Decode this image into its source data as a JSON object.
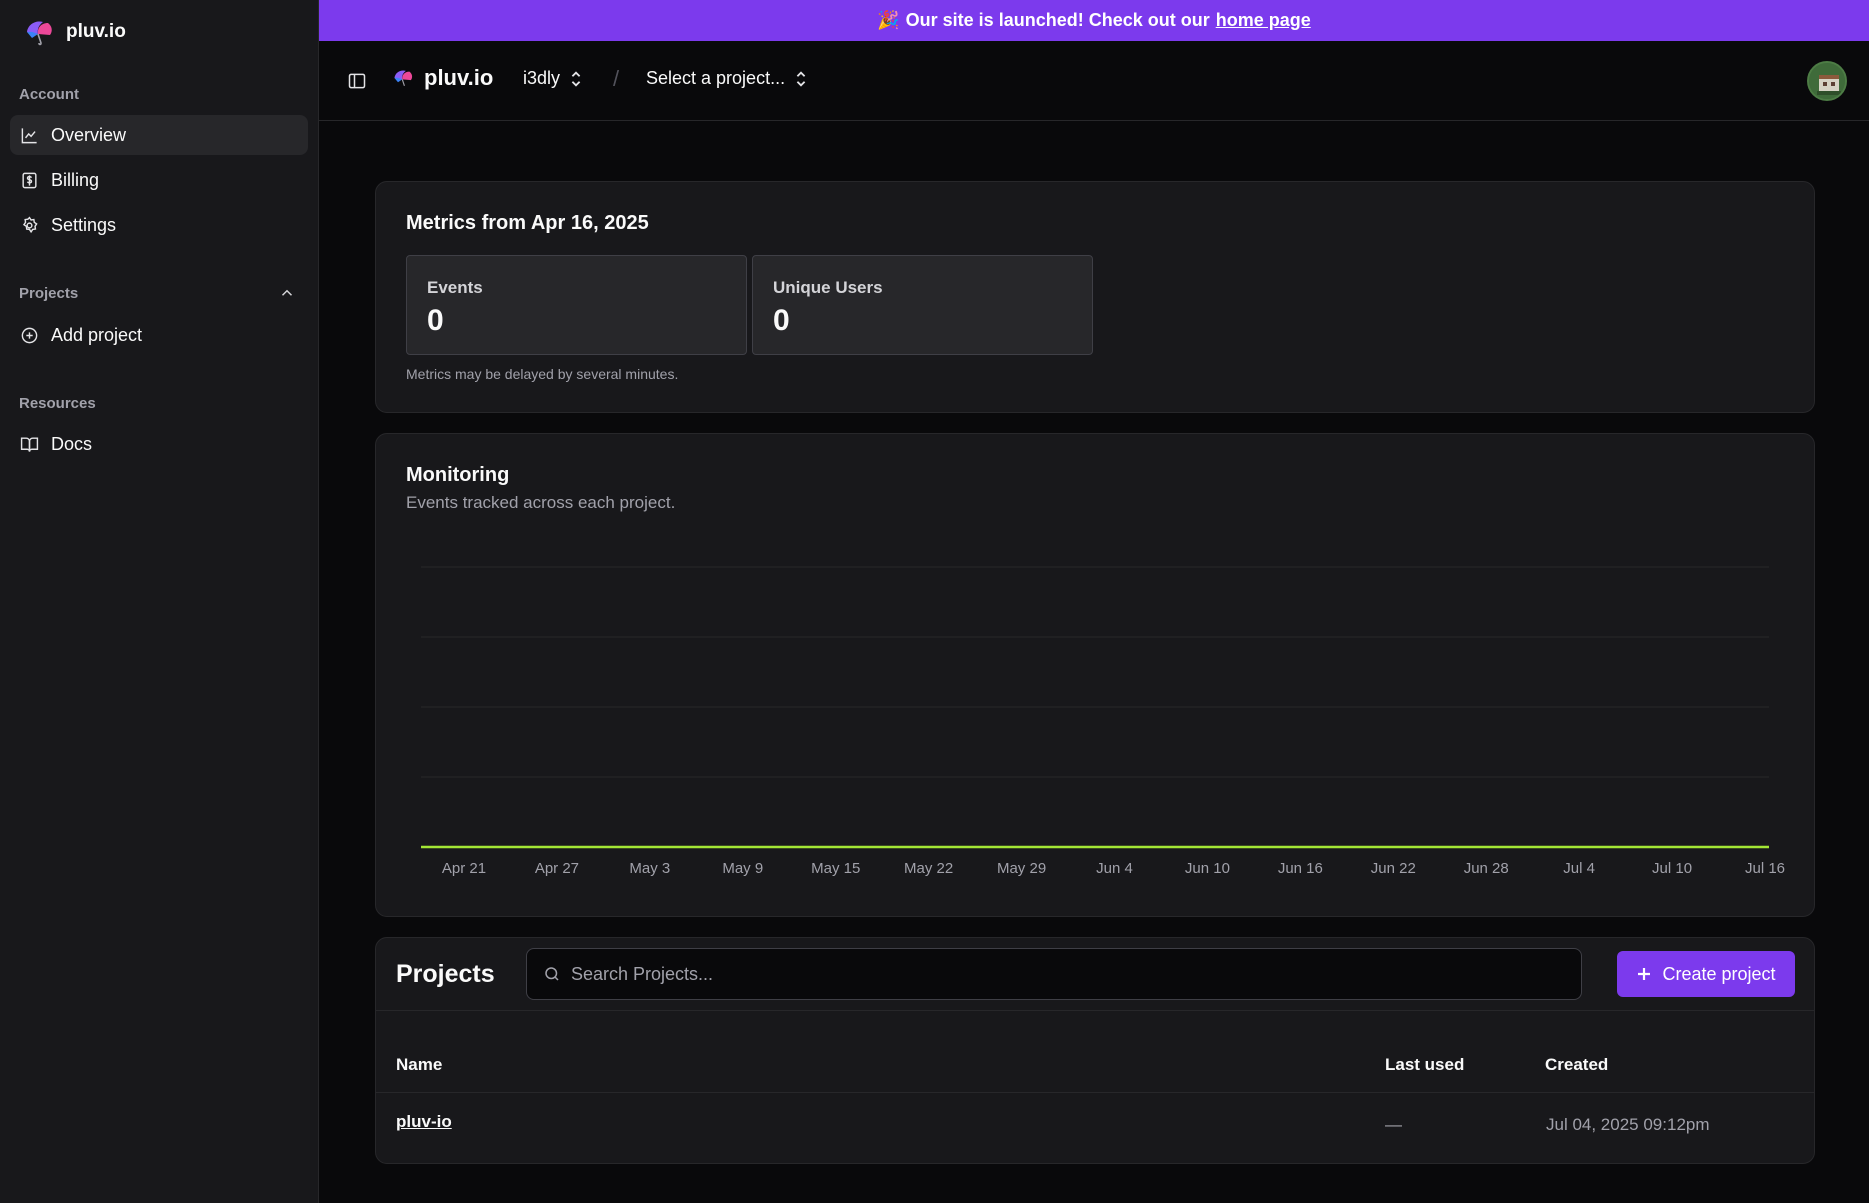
{
  "sidebar": {
    "brand": "pluv.io",
    "sections": {
      "account": "Account",
      "projects": "Projects",
      "resources": "Resources"
    },
    "items": [
      {
        "label": "Overview",
        "icon": "chart-line-icon"
      },
      {
        "label": "Billing",
        "icon": "dollar-receipt-icon"
      },
      {
        "label": "Settings",
        "icon": "gear-icon"
      },
      {
        "label": "Add project",
        "icon": "plus-circle-icon"
      },
      {
        "label": "Docs",
        "icon": "book-icon"
      }
    ]
  },
  "banner": {
    "emoji": "🎉",
    "text": "Our site is launched! Check out our",
    "link": "home page"
  },
  "topbar": {
    "brand": "pluv.io",
    "org": "i3dly",
    "separator": "/",
    "project_placeholder": "Select a project..."
  },
  "metrics": {
    "title": "Metrics from Apr 16, 2025",
    "events_label": "Events",
    "events_value": "0",
    "users_label": "Unique Users",
    "users_value": "0",
    "note": "Metrics may be delayed by several minutes."
  },
  "monitoring": {
    "title": "Monitoring",
    "subtitle": "Events tracked across each project."
  },
  "chart_data": {
    "type": "area",
    "x": [
      "Apr 21",
      "Apr 27",
      "May 3",
      "May 9",
      "May 15",
      "May 22",
      "May 29",
      "Jun 4",
      "Jun 10",
      "Jun 16",
      "Jun 22",
      "Jun 28",
      "Jul 4",
      "Jul 10",
      "Jul 16"
    ],
    "series": [
      {
        "values": [
          0,
          0,
          0,
          0,
          0,
          0,
          0,
          0,
          0,
          0,
          0,
          0,
          0,
          0,
          0
        ],
        "color": "#a3e635"
      }
    ],
    "ylim": [
      0,
      4
    ],
    "grid": true
  },
  "projects": {
    "title": "Projects",
    "search_placeholder": "Search Projects...",
    "create_label": "Create project",
    "columns": [
      "Name",
      "Last used",
      "Created"
    ],
    "rows": [
      {
        "name": "pluv-io",
        "last_used": "—",
        "created": "Jul 04, 2025 09:12pm"
      }
    ]
  },
  "colors": {
    "accent": "#7c3aed",
    "background": "#09090b",
    "card": "#18181b",
    "line": "#a3e635"
  }
}
